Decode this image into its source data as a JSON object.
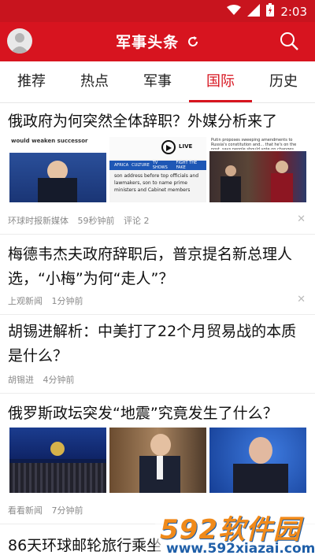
{
  "status": {
    "time": "2:03"
  },
  "appbar": {
    "title": "军事头条"
  },
  "tabs": [
    {
      "label": "推荐"
    },
    {
      "label": "热点"
    },
    {
      "label": "军事"
    },
    {
      "label": "国际"
    },
    {
      "label": "历史"
    }
  ],
  "active_tab": "国际",
  "articles": [
    {
      "headline": "俄政府为何突然全体辞职？外媒分析来了",
      "source": "环球时报新媒体",
      "time": "59秒钟前",
      "comments": "评论 2",
      "images": [
        {
          "text_top": "would weaken successor"
        },
        {
          "text": "LIVE",
          "tags": [
            "AFRICA",
            "CULTURE",
            "TV SHOWS",
            "FIGHT THE FAKE"
          ],
          "caption": "son address before top officials and lawmakers, son to name prime ministers and Cabinet members"
        },
        {
          "text_top": "Putin proposes sweeping amendments to Russia's constitution and... that he's on the post, says people should vote on changes"
        }
      ]
    },
    {
      "headline": "梅德韦杰夫政府辞职后，普京提名新总理人选，“小梅”为何“走人”？",
      "source": "上观新闻",
      "time": "1分钟前"
    },
    {
      "headline": "胡锡进解析：中美打了22个月贸易战的本质是什么？",
      "source": "胡锡进",
      "time": "4分钟前"
    },
    {
      "headline": "俄罗斯政坛突发“地震”究竟发生了什么？",
      "source": "看看新闻",
      "time": "7分钟前"
    },
    {
      "headline": "86天环球邮轮旅行乘坐"
    }
  ],
  "watermark": {
    "big": "592软件园",
    "small": "www.592xiazai.com"
  }
}
